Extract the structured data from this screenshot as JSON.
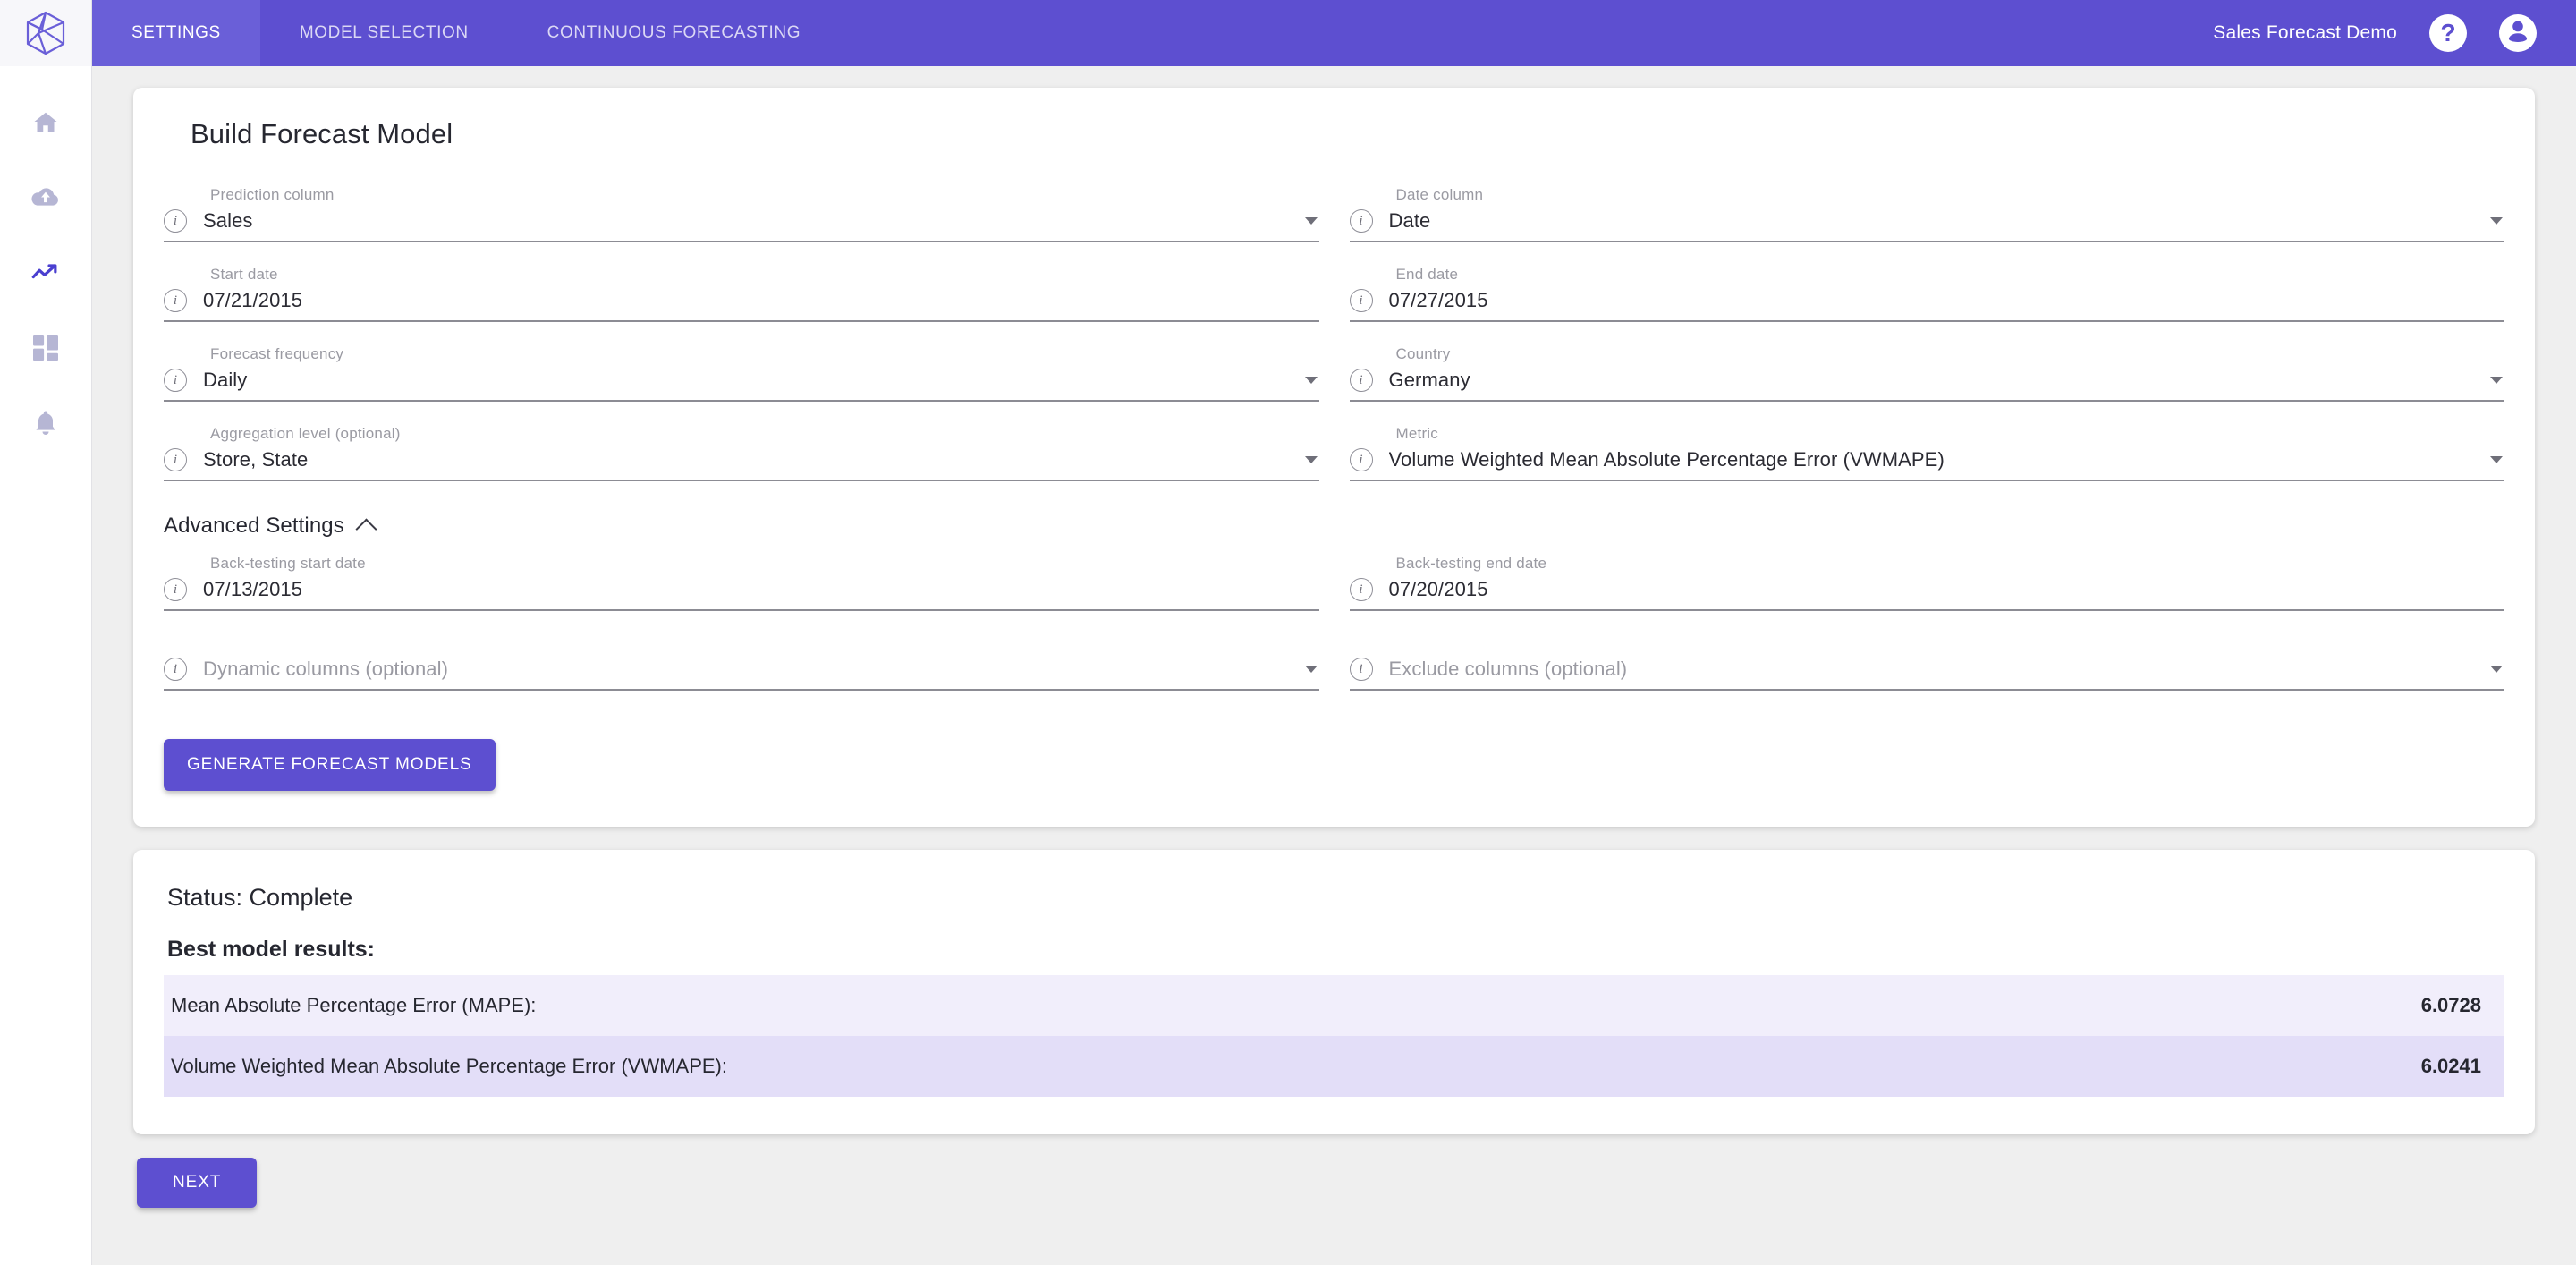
{
  "header": {
    "tabs": [
      {
        "label": "SETTINGS",
        "active": true
      },
      {
        "label": "MODEL SELECTION",
        "active": false
      },
      {
        "label": "CONTINUOUS FORECASTING",
        "active": false
      }
    ],
    "project_title": "Sales Forecast Demo",
    "help_label": "?",
    "accent_color": "#5d4fd0",
    "active_tab_color": "#6a5fd8"
  },
  "sidebar": {
    "items": [
      {
        "icon": "home-icon",
        "active": false
      },
      {
        "icon": "cloud-upload-icon",
        "active": false
      },
      {
        "icon": "trending-up-icon",
        "active": true
      },
      {
        "icon": "dashboard-grid-icon",
        "active": false
      },
      {
        "icon": "bell-icon",
        "active": false
      }
    ],
    "icon_color": "#b6b6d4",
    "active_icon_color": "#4a3fd0"
  },
  "form": {
    "title": "Build Forecast Model",
    "fields": {
      "prediction_column": {
        "label": "Prediction column",
        "value": "Sales"
      },
      "date_column": {
        "label": "Date column",
        "value": "Date"
      },
      "start_date": {
        "label": "Start date",
        "value": "07/21/2015"
      },
      "end_date": {
        "label": "End date",
        "value": "07/27/2015"
      },
      "forecast_frequency": {
        "label": "Forecast frequency",
        "value": "Daily"
      },
      "country": {
        "label": "Country",
        "value": "Germany"
      },
      "aggregation_level": {
        "label": "Aggregation level (optional)",
        "value": "Store, State"
      },
      "metric": {
        "label": "Metric",
        "value": "Volume Weighted Mean Absolute Percentage Error (VWMAPE)"
      },
      "backtest_start_date": {
        "label": "Back-testing start date",
        "value": "07/13/2015"
      },
      "backtest_end_date": {
        "label": "Back-testing end date",
        "value": "07/20/2015"
      },
      "dynamic_columns": {
        "label": "",
        "placeholder": "Dynamic columns (optional)"
      },
      "exclude_columns": {
        "label": "",
        "placeholder": "Exclude columns (optional)"
      }
    },
    "advanced_settings_label": "Advanced Settings",
    "generate_button": "GENERATE FORECAST MODELS"
  },
  "status": {
    "status_line": "Status: Complete",
    "results_title": "Best model results:",
    "results": [
      {
        "label": "Mean Absolute Percentage Error (MAPE):",
        "value": "6.0728"
      },
      {
        "label": "Volume Weighted Mean Absolute Percentage Error (VWMAPE):",
        "value": "6.0241"
      }
    ]
  },
  "footer": {
    "next_button": "NEXT"
  }
}
